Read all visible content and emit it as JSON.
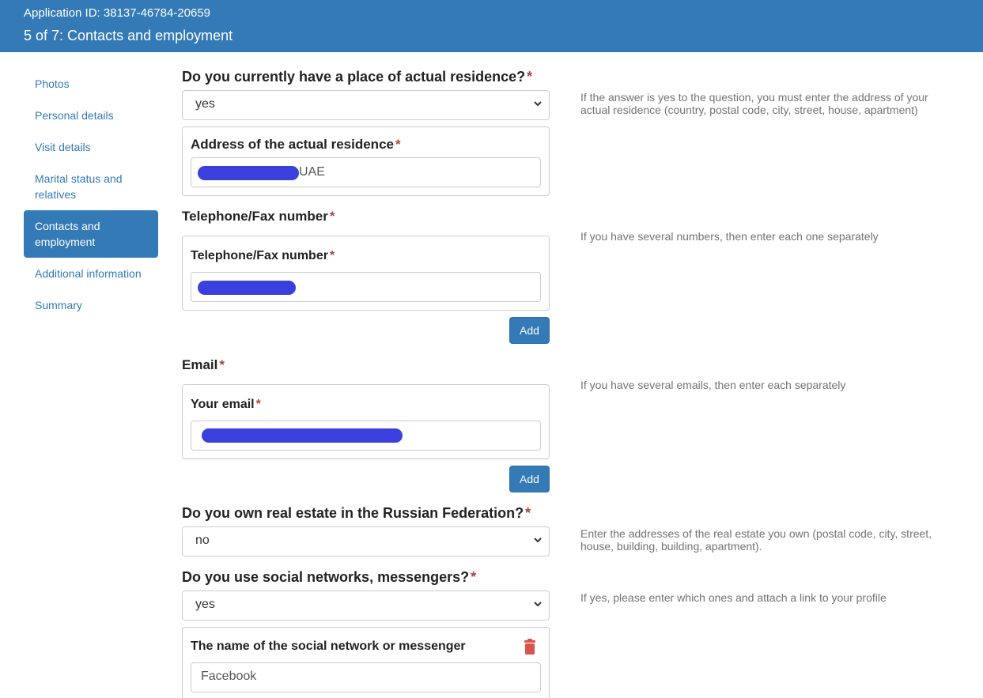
{
  "header": {
    "app_id": "Application ID: 38137-46784-20659",
    "step": "5 of 7: Contacts and employment"
  },
  "sidebar": {
    "items": [
      {
        "label": "Photos"
      },
      {
        "label": "Personal details"
      },
      {
        "label": "Visit details"
      },
      {
        "label": "Marital status and relatives"
      },
      {
        "label": "Contacts and employment",
        "active": true
      },
      {
        "label": "Additional information"
      },
      {
        "label": "Summary"
      }
    ]
  },
  "residence": {
    "question": "Do you currently have a place of actual residence?",
    "answer": "yes",
    "hint": "If the answer is yes to the question, you must enter the address of your actual residence (country, postal code, city, street, house, apartment)",
    "address_label": "Address of the actual residence",
    "address_value": "UAE"
  },
  "phone": {
    "section_label": "Telephone/Fax number",
    "field_label": "Telephone/Fax number",
    "add_label": "Add",
    "hint": "If you have several numbers, then enter each one separately"
  },
  "email": {
    "section_label": "Email",
    "field_label": "Your email",
    "add_label": "Add",
    "hint": "If you have several emails, then enter each separately"
  },
  "real_estate": {
    "question": "Do you own real estate in the Russian Federation?",
    "answer": "no",
    "hint": "Enter the addresses of the real estate you own (postal code, city, street, house, building, building, apartment)."
  },
  "social": {
    "question": "Do you use social networks, messengers?",
    "answer": "yes",
    "hint": "If yes, please enter which ones and attach a link to your profile",
    "network_label": "The name of the social network or messenger",
    "network_value": "Facebook"
  },
  "required_mark": "*",
  "colors": {
    "primary": "#337ab7",
    "required": "#a94442",
    "redaction": "#3b3fdc",
    "delete": "#d9534f"
  },
  "icons": {
    "select_arrow": "chevron-down-icon",
    "delete": "trash-icon"
  }
}
